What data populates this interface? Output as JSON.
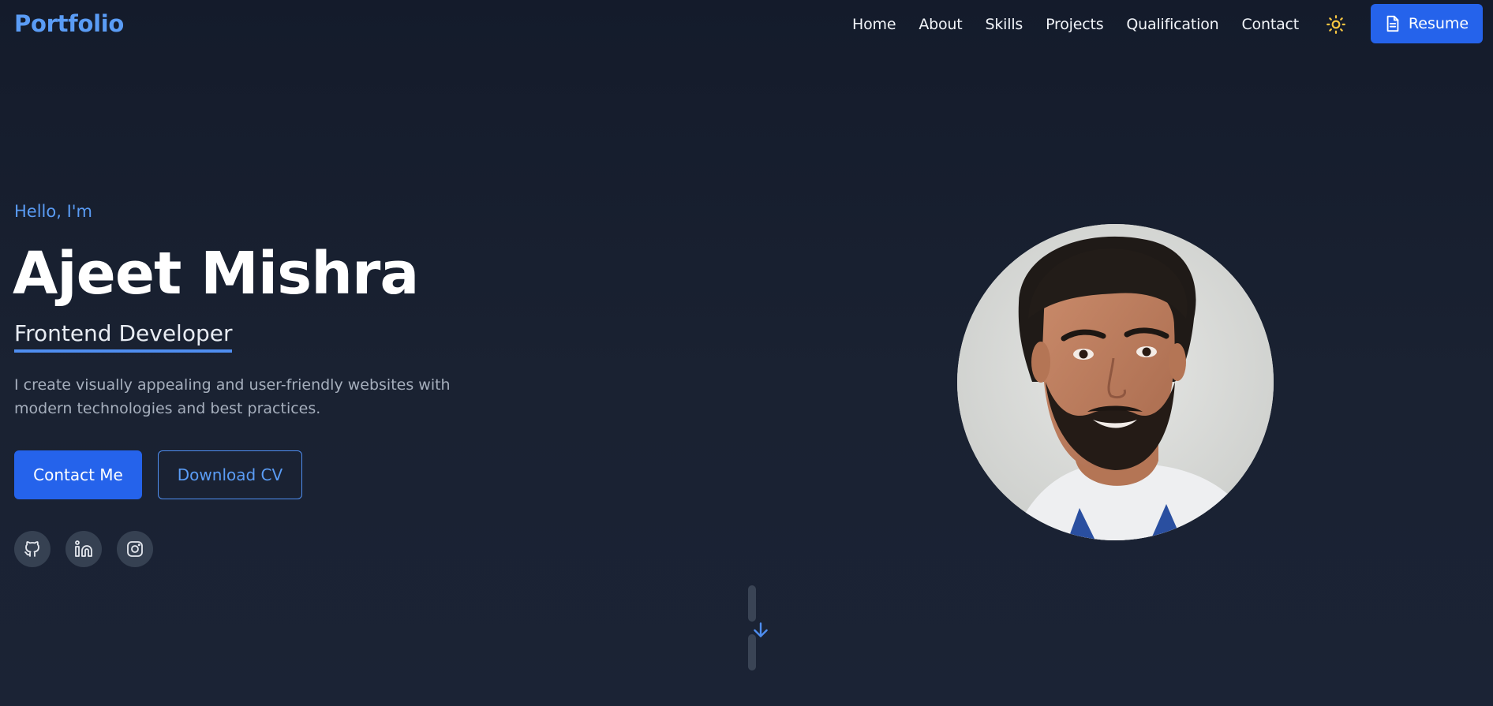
{
  "header": {
    "logo": "Portfolio",
    "nav": [
      "Home",
      "About",
      "Skills",
      "Projects",
      "Qualification",
      "Contact"
    ],
    "theme_icon": "sun-icon",
    "resume_label": "Resume",
    "resume_icon": "document-icon"
  },
  "hero": {
    "greeting": "Hello, I'm",
    "name": "Ajeet Mishra",
    "role": "Frontend Developer",
    "description": "I create visually appealing and user-friendly websites with modern technologies and best practices.",
    "contact_label": "Contact Me",
    "download_label": "Download CV",
    "socials": [
      "github-icon",
      "linkedin-icon",
      "instagram-icon"
    ]
  },
  "scroll_icon": "arrow-down-icon",
  "colors": {
    "accent": "#2563eb",
    "accent_text": "#5a9cf5",
    "background": "#161d2d",
    "social_bg": "#364152"
  }
}
